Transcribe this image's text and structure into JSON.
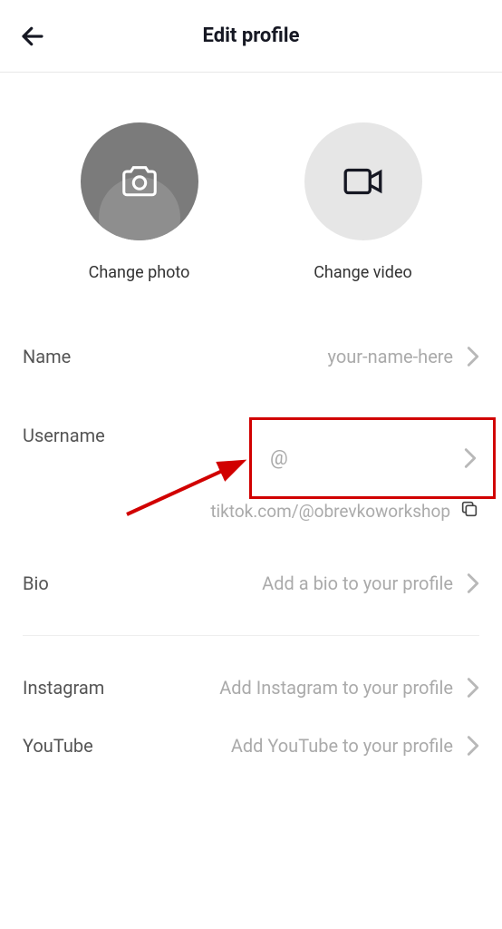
{
  "header": {
    "title": "Edit profile"
  },
  "media": {
    "change_photo": "Change photo",
    "change_video": "Change video"
  },
  "fields": {
    "name": {
      "label": "Name",
      "value": "your-name-here"
    },
    "username": {
      "label": "Username",
      "value": "@"
    },
    "profile_link": {
      "text": "tiktok.com/@obrevkoworkshop"
    },
    "bio": {
      "label": "Bio",
      "value": "Add a bio to your profile"
    },
    "instagram": {
      "label": "Instagram",
      "value": "Add Instagram to your profile"
    },
    "youtube": {
      "label": "YouTube",
      "value": "Add YouTube to your profile"
    }
  }
}
